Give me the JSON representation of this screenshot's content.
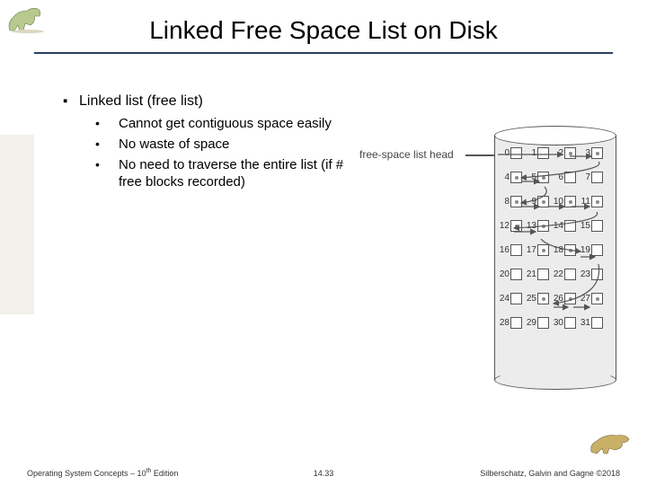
{
  "title": "Linked Free Space List on Disk",
  "list": {
    "heading": "Linked list (free list)",
    "items": [
      "Cannot get contiguous space easily",
      "No waste of space",
      "No need to traverse the entire list (if # free blocks recorded)"
    ]
  },
  "diagram": {
    "label": "free-space list head",
    "free_blocks": [
      2,
      3,
      4,
      5,
      8,
      9,
      10,
      11,
      12,
      13,
      17,
      18,
      25,
      26,
      27
    ],
    "cols": 4,
    "rows": 8
  },
  "footer": {
    "left_a": "Operating System Concepts – 10",
    "left_b": " Edition",
    "center": "14.33",
    "right": "Silberschatz, Galvin and Gagne ©2018"
  }
}
